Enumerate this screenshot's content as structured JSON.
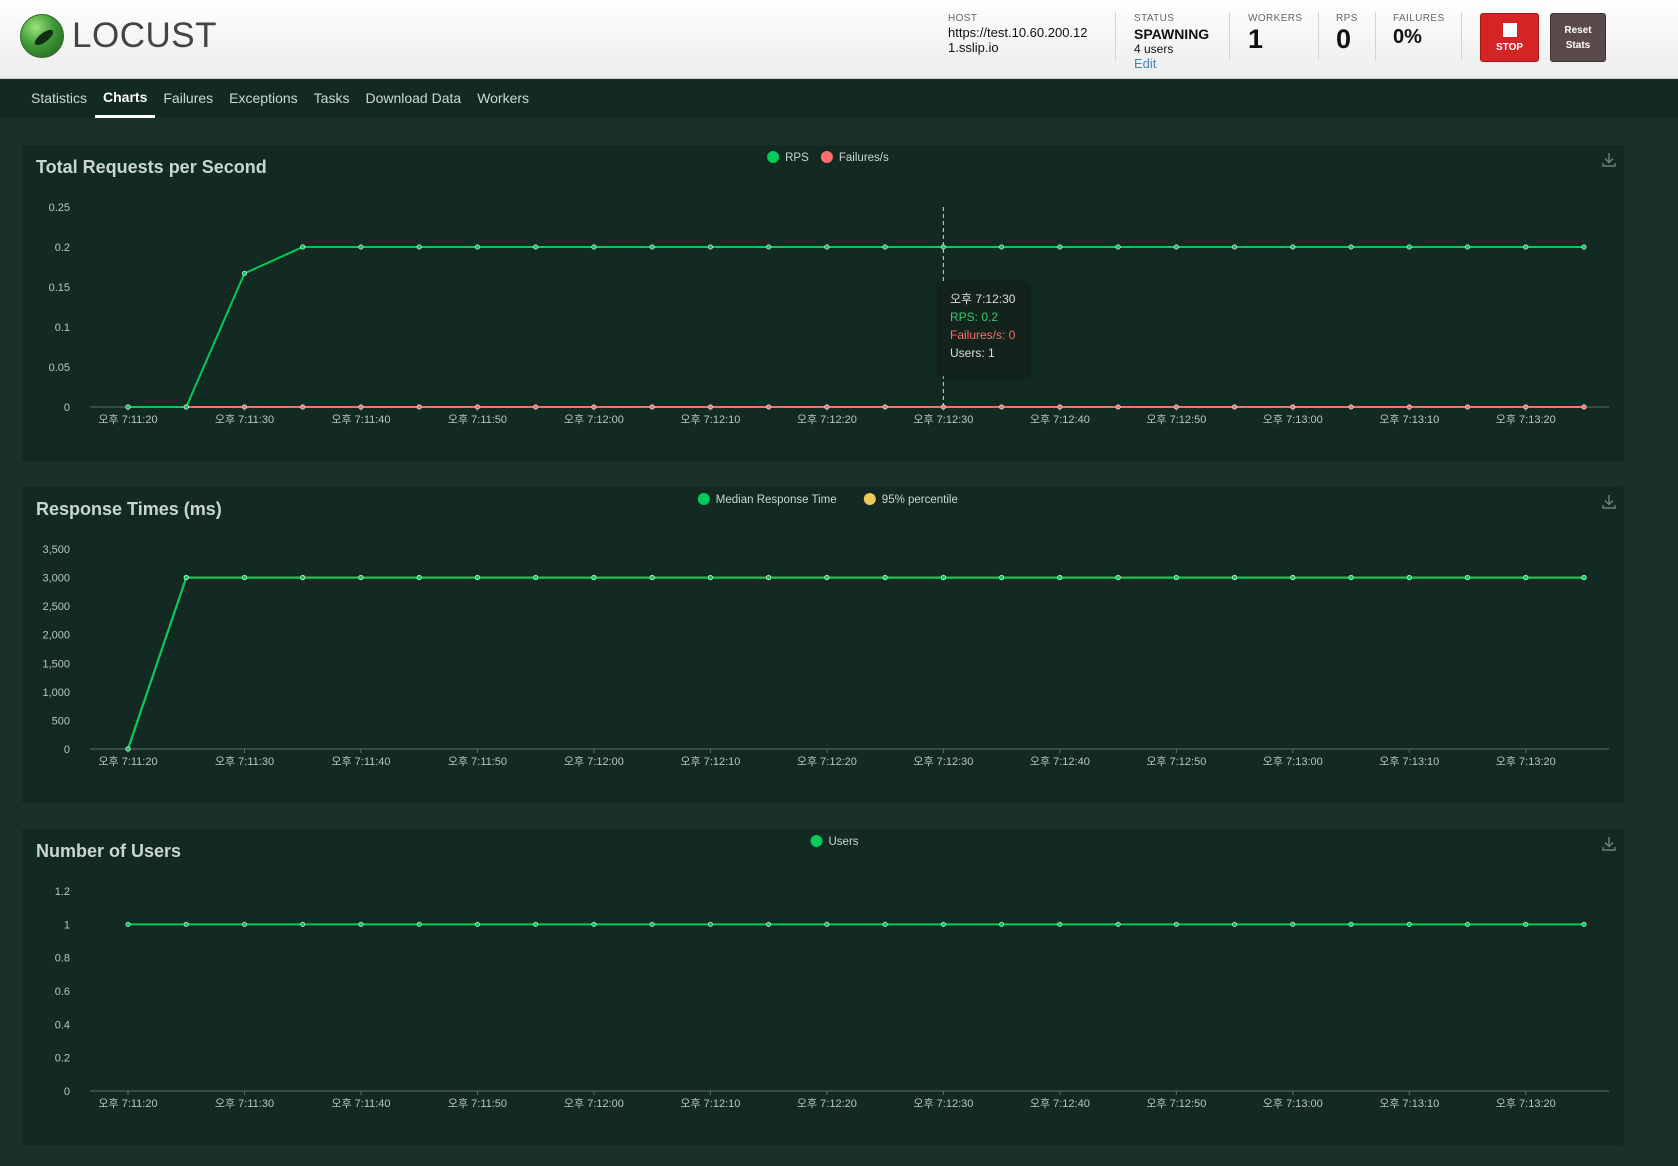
{
  "app": {
    "name": "LOCUST"
  },
  "header": {
    "host": {
      "label": "HOST",
      "value": "https://test.10.60.200.121.sslip.io"
    },
    "status": {
      "label": "STATUS",
      "value": "SPAWNING",
      "users": "4 users",
      "edit": "Edit"
    },
    "workers": {
      "label": "WORKERS",
      "value": "1"
    },
    "rps": {
      "label": "RPS",
      "value": "0"
    },
    "failures": {
      "label": "FAILURES",
      "value": "0%"
    },
    "stop_label": "STOP",
    "reset_label": "Reset Stats"
  },
  "tabs": [
    {
      "label": "Statistics",
      "active": false
    },
    {
      "label": "Charts",
      "active": true
    },
    {
      "label": "Failures",
      "active": false
    },
    {
      "label": "Exceptions",
      "active": false
    },
    {
      "label": "Tasks",
      "active": false
    },
    {
      "label": "Download Data",
      "active": false
    },
    {
      "label": "Workers",
      "active": false
    }
  ],
  "colors": {
    "green": "#00ca5a",
    "red": "#ff6d6d",
    "yellow": "#eeca58",
    "panel": "#132a22",
    "background": "#1a3028"
  },
  "tooltip": {
    "time": "오후 7:12:30",
    "rps": "RPS: 0.2",
    "failures": "Failures/s: 0",
    "users": "Users: 1"
  },
  "chart_data": [
    {
      "type": "line",
      "title": "Total Requests per Second",
      "x": [
        "오후 7:11:20",
        "오후 7:11:25",
        "오후 7:11:30",
        "오후 7:11:35",
        "오후 7:11:40",
        "오후 7:11:45",
        "오후 7:11:50",
        "오후 7:11:55",
        "오후 7:12:00",
        "오후 7:12:05",
        "오후 7:12:10",
        "오후 7:12:15",
        "오후 7:12:20",
        "오후 7:12:25",
        "오후 7:12:30",
        "오후 7:12:35",
        "오후 7:12:40",
        "오후 7:12:45",
        "오후 7:12:50",
        "오후 7:12:55",
        "오후 7:13:00",
        "오후 7:13:05",
        "오후 7:13:10",
        "오후 7:13:15",
        "오후 7:13:20",
        "오후 7:13:25"
      ],
      "x_ticks": [
        "오후 7:11:20",
        "오후 7:11:30",
        "오후 7:11:40",
        "오후 7:11:50",
        "오후 7:12:00",
        "오후 7:12:10",
        "오후 7:12:20",
        "오후 7:12:30",
        "오후 7:12:40",
        "오후 7:12:50",
        "오후 7:13:00",
        "오후 7:13:10",
        "오후 7:13:20"
      ],
      "y_ticks": [
        "0",
        "0.05",
        "0.1",
        "0.15",
        "0.2",
        "0.25"
      ],
      "ylim": [
        0,
        0.25
      ],
      "series": [
        {
          "name": "RPS",
          "color": "#00ca5a",
          "values": [
            0,
            0,
            0.167,
            0.2,
            0.2,
            0.2,
            0.2,
            0.2,
            0.2,
            0.2,
            0.2,
            0.2,
            0.2,
            0.2,
            0.2,
            0.2,
            0.2,
            0.2,
            0.2,
            0.2,
            0.2,
            0.2,
            0.2,
            0.2,
            0.2,
            0.2
          ]
        },
        {
          "name": "Failures/s",
          "color": "#ff6d6d",
          "values": [
            0,
            0,
            0,
            0,
            0,
            0,
            0,
            0,
            0,
            0,
            0,
            0,
            0,
            0,
            0,
            0,
            0,
            0,
            0,
            0,
            0,
            0,
            0,
            0,
            0,
            0
          ]
        }
      ],
      "hover_index": 14
    },
    {
      "type": "line",
      "title": "Response Times (ms)",
      "x": [
        "오후 7:11:20",
        "오후 7:11:25",
        "오후 7:11:30",
        "오후 7:11:35",
        "오후 7:11:40",
        "오후 7:11:45",
        "오후 7:11:50",
        "오후 7:11:55",
        "오후 7:12:00",
        "오후 7:12:05",
        "오후 7:12:10",
        "오후 7:12:15",
        "오후 7:12:20",
        "오후 7:12:25",
        "오후 7:12:30",
        "오후 7:12:35",
        "오후 7:12:40",
        "오후 7:12:45",
        "오후 7:12:50",
        "오후 7:12:55",
        "오후 7:13:00",
        "오후 7:13:05",
        "오후 7:13:10",
        "오후 7:13:15",
        "오후 7:13:20",
        "오후 7:13:25"
      ],
      "x_ticks": [
        "오후 7:11:20",
        "오후 7:11:30",
        "오후 7:11:40",
        "오후 7:11:50",
        "오후 7:12:00",
        "오후 7:12:10",
        "오후 7:12:20",
        "오후 7:12:30",
        "오후 7:12:40",
        "오후 7:12:50",
        "오후 7:13:00",
        "오후 7:13:10",
        "오후 7:13:20"
      ],
      "y_ticks": [
        "0",
        "500",
        "1,000",
        "1,500",
        "2,000",
        "2,500",
        "3,000",
        "3,500"
      ],
      "ylim": [
        0,
        3500
      ],
      "series": [
        {
          "name": "Median Response Time",
          "color": "#00ca5a",
          "values": [
            0,
            3000,
            3000,
            3000,
            3000,
            3000,
            3000,
            3000,
            3000,
            3000,
            3000,
            3000,
            3000,
            3000,
            3000,
            3000,
            3000,
            3000,
            3000,
            3000,
            3000,
            3000,
            3000,
            3000,
            3000,
            3000
          ]
        },
        {
          "name": "95% percentile",
          "color": "#eeca58",
          "values": [
            0,
            3000,
            3000,
            3000,
            3000,
            3000,
            3000,
            3000,
            3000,
            3000,
            3000,
            3000,
            3000,
            3000,
            3000,
            3000,
            3000,
            3000,
            3000,
            3000,
            3000,
            3000,
            3000,
            3000,
            3000,
            3000
          ]
        }
      ]
    },
    {
      "type": "line",
      "title": "Number of Users",
      "x": [
        "오후 7:11:20",
        "오후 7:11:25",
        "오후 7:11:30",
        "오후 7:11:35",
        "오후 7:11:40",
        "오후 7:11:45",
        "오후 7:11:50",
        "오후 7:11:55",
        "오후 7:12:00",
        "오후 7:12:05",
        "오후 7:12:10",
        "오후 7:12:15",
        "오후 7:12:20",
        "오후 7:12:25",
        "오후 7:12:30",
        "오후 7:12:35",
        "오후 7:12:40",
        "오후 7:12:45",
        "오후 7:12:50",
        "오후 7:12:55",
        "오후 7:13:00",
        "오후 7:13:05",
        "오후 7:13:10",
        "오후 7:13:15",
        "오후 7:13:20",
        "오후 7:13:25"
      ],
      "x_ticks": [
        "오후 7:11:20",
        "오후 7:11:30",
        "오후 7:11:40",
        "오후 7:11:50",
        "오후 7:12:00",
        "오후 7:12:10",
        "오후 7:12:20",
        "오후 7:12:30",
        "오후 7:12:40",
        "오후 7:12:50",
        "오후 7:13:00",
        "오후 7:13:10",
        "오후 7:13:20"
      ],
      "y_ticks": [
        "0",
        "0.2",
        "0.4",
        "0.6",
        "0.8",
        "1",
        "1.2"
      ],
      "ylim": [
        0,
        1.2
      ],
      "series": [
        {
          "name": "Users",
          "color": "#00ca5a",
          "values": [
            1,
            1,
            1,
            1,
            1,
            1,
            1,
            1,
            1,
            1,
            1,
            1,
            1,
            1,
            1,
            1,
            1,
            1,
            1,
            1,
            1,
            1,
            1,
            1,
            1,
            1
          ]
        }
      ]
    }
  ]
}
